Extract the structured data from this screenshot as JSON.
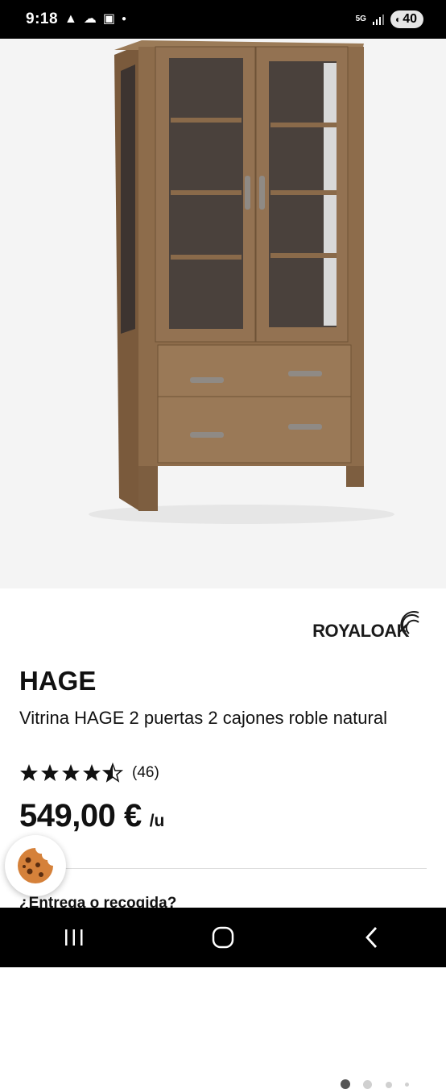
{
  "status_bar": {
    "time": "9:18",
    "left_icons": [
      "alert-icon",
      "cloud-icon",
      "gallery-icon",
      "dot-icon"
    ],
    "network": "5G",
    "battery": "40"
  },
  "gallery": {
    "image_name": "vitrina-hage-image",
    "total_slides": 4,
    "active_slide": 1
  },
  "product": {
    "brand_logo": "ROYALOAK",
    "name": "HAGE",
    "description": "Vitrina HAGE 2 puertas 2 cajones roble natural",
    "rating": 4.5,
    "rating_count": "(46)",
    "price": "549,00 €",
    "price_unit": "/u"
  },
  "delivery_section": {
    "heading": "¿Entrega o recogida?"
  },
  "nav_bar": {
    "buttons": [
      "recent-apps",
      "home",
      "back"
    ]
  },
  "colors": {
    "wood": "#8a6a4a",
    "background": "#f4f4f4",
    "status_bar": "#000000"
  }
}
